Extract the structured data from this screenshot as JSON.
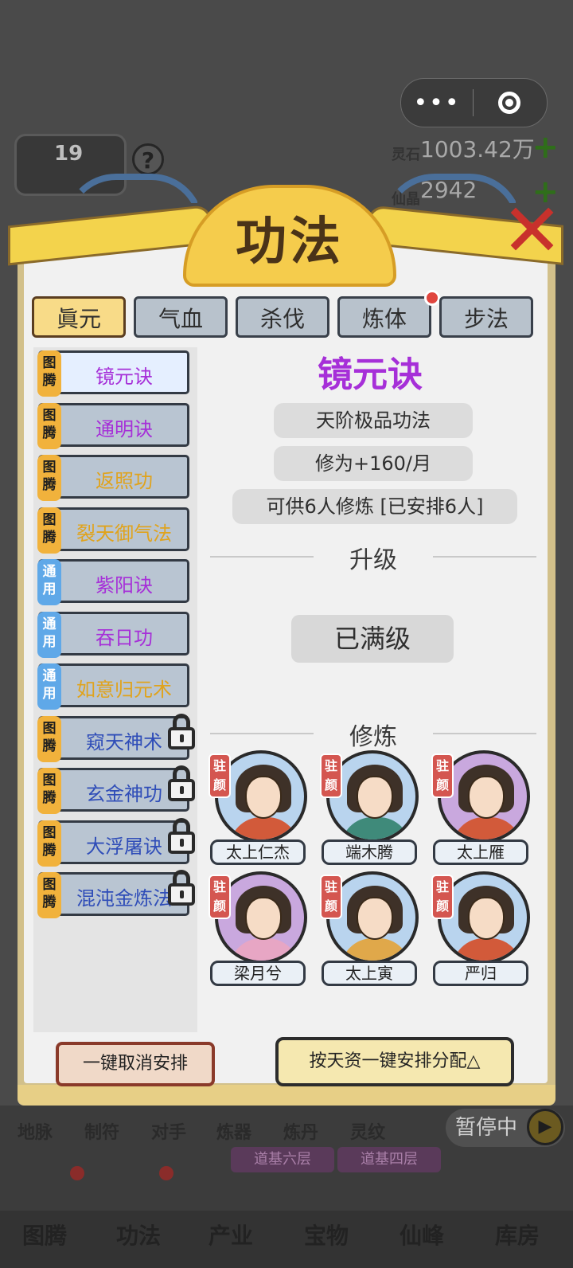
{
  "top_bar": {
    "menu_dots": "•••",
    "level": "19",
    "help": "?",
    "resources": [
      {
        "label": "灵石",
        "value": "1003.42万",
        "plus": "+"
      },
      {
        "label": "仙晶",
        "value": "2942",
        "plus": "+"
      }
    ]
  },
  "modal": {
    "title": "功法",
    "close": "✕",
    "tabs": [
      {
        "label": "眞元",
        "active": true
      },
      {
        "label": "气血",
        "active": false
      },
      {
        "label": "杀伐",
        "active": false
      },
      {
        "label": "炼体",
        "active": false,
        "notification": true
      },
      {
        "label": "步法",
        "active": false
      }
    ],
    "skills": [
      {
        "tag": "图腾",
        "name": "镜元诀",
        "color": "#a62fd8",
        "locked": false,
        "active": true
      },
      {
        "tag": "图腾",
        "name": "通明诀",
        "color": "#a62fd8",
        "locked": false
      },
      {
        "tag": "图腾",
        "name": "返照功",
        "color": "#e0a31c",
        "locked": false
      },
      {
        "tag": "图腾",
        "name": "裂天御气法",
        "color": "#e0a31c",
        "locked": false
      },
      {
        "tag": "通用",
        "name": "紫阳诀",
        "color": "#a62fd8",
        "locked": false
      },
      {
        "tag": "通用",
        "name": "吞日功",
        "color": "#a62fd8",
        "locked": false
      },
      {
        "tag": "通用",
        "name": "如意归元术",
        "color": "#e0a31c",
        "locked": false
      },
      {
        "tag": "图腾",
        "name": "窥天神术",
        "color": "#2f4db8",
        "locked": true
      },
      {
        "tag": "图腾",
        "name": "玄金神功",
        "color": "#2f4db8",
        "locked": true
      },
      {
        "tag": "图腾",
        "name": "大浮屠诀",
        "color": "#2f4db8",
        "locked": true
      },
      {
        "tag": "图腾",
        "name": "混沌金炼法",
        "color": "#2f4db8",
        "locked": true
      }
    ],
    "detail": {
      "name": "镜元诀",
      "grade": "天阶极品功法",
      "gain": "修为+160/月",
      "capacity": "可供6人修炼  [已安排6人]",
      "upgrade_header": "升级",
      "max_level": "已满级",
      "cultivate_header": "修炼",
      "badge": "驻颜",
      "cultivators": [
        {
          "name": "太上仁杰",
          "ring": "#b9d4ee",
          "robe": "#d25a3a"
        },
        {
          "name": "端木腾",
          "ring": "#b9d4ee",
          "robe": "#3f8a7a"
        },
        {
          "name": "太上雁",
          "ring": "#c9a8de",
          "robe": "#d25a3a"
        },
        {
          "name": "梁月兮",
          "ring": "#c9a8de",
          "robe": "#e7a6c4"
        },
        {
          "name": "太上寅",
          "ring": "#b9d4ee",
          "robe": "#e0a84a"
        },
        {
          "name": "严归",
          "ring": "#b9d4ee",
          "robe": "#d25a3a"
        }
      ]
    },
    "buttons": {
      "cancel_all": "一键取消安排",
      "auto_assign": "按天资一键安排分配△"
    }
  },
  "background": {
    "sub_labels": [
      "地脉",
      "制符",
      "对手",
      "炼器",
      "炼丹",
      "灵纹"
    ],
    "pause": "暂停中",
    "floors": [
      "道基六层",
      "道基四层"
    ],
    "nav": [
      "图腾",
      "功法",
      "产业",
      "宝物",
      "仙峰",
      "库房"
    ]
  }
}
